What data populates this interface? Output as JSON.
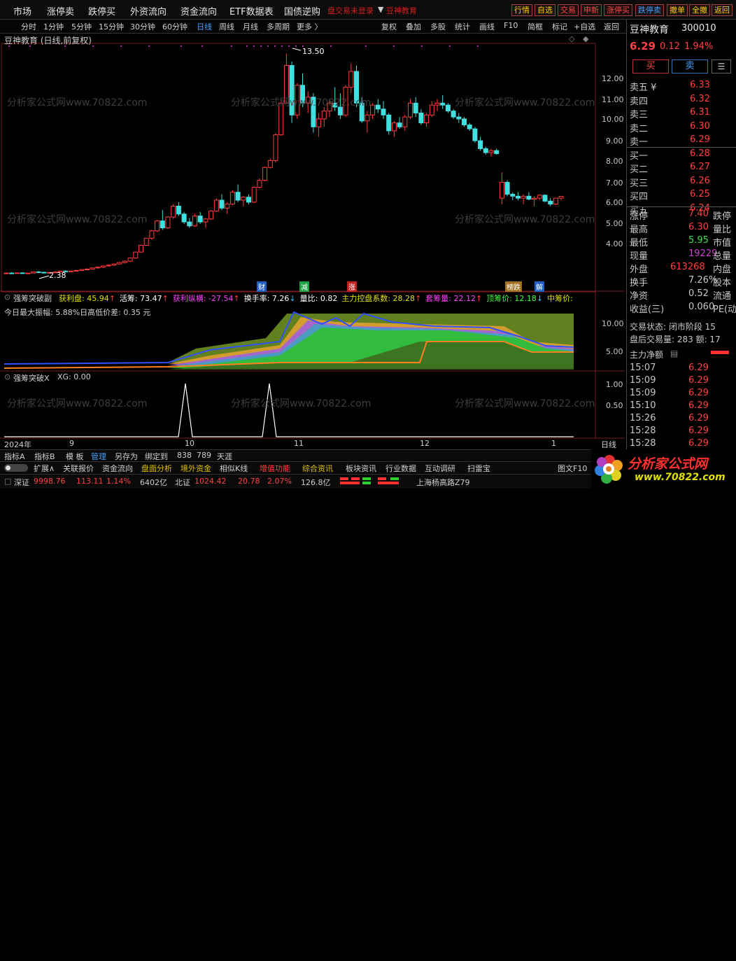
{
  "menu": {
    "items": [
      "市场",
      "涨停卖",
      "跌停买",
      "外资流向",
      "资金流向",
      "ETF数据表",
      "国债逆购"
    ],
    "notice": "盘交易未登录",
    "brand": "豆神教育",
    "right_buttons": [
      "行情",
      "自选",
      "交易",
      "申新",
      "涨停买",
      "跌停卖",
      "撤单",
      "全撤",
      "返回"
    ]
  },
  "toolbar": {
    "periods": [
      "分时",
      "1分钟",
      "5分钟",
      "15分钟",
      "30分钟",
      "60分钟",
      "日线",
      "周线",
      "月线",
      "多周期",
      "更多 〉"
    ],
    "tools": [
      "复权",
      "叠加",
      "多股",
      "统计",
      "画线",
      "F10",
      "简框",
      "标记",
      "+自选",
      "返回"
    ]
  },
  "main_chart": {
    "title": "豆神教育 (日线,前复权)",
    "high_label": "13.50",
    "low_label": "2.38",
    "y_ticks": [
      "12.00",
      "11.00",
      "10.00",
      "9.00",
      "8.00",
      "7.00",
      "6.00",
      "5.00",
      "4.00"
    ],
    "candles_ohlc": [
      [
        2.4,
        2.45,
        2.38,
        2.42
      ],
      [
        2.42,
        2.46,
        2.39,
        2.41
      ],
      [
        2.41,
        2.44,
        2.39,
        2.43
      ],
      [
        2.43,
        2.45,
        2.38,
        2.4
      ],
      [
        2.4,
        2.44,
        2.38,
        2.42
      ],
      [
        2.42,
        2.5,
        2.41,
        2.48
      ],
      [
        2.48,
        2.52,
        2.44,
        2.46
      ],
      [
        2.46,
        2.48,
        2.4,
        2.42
      ],
      [
        2.42,
        2.46,
        2.4,
        2.45
      ],
      [
        2.45,
        2.5,
        2.43,
        2.47
      ],
      [
        2.47,
        2.55,
        2.45,
        2.52
      ],
      [
        2.52,
        2.56,
        2.48,
        2.5
      ],
      [
        2.5,
        2.54,
        2.48,
        2.52
      ],
      [
        2.52,
        2.58,
        2.5,
        2.55
      ],
      [
        2.55,
        2.62,
        2.53,
        2.6
      ],
      [
        2.6,
        2.66,
        2.56,
        2.62
      ],
      [
        2.62,
        2.7,
        2.6,
        2.68
      ],
      [
        2.68,
        2.75,
        2.64,
        2.72
      ],
      [
        2.72,
        2.8,
        2.68,
        2.78
      ],
      [
        2.78,
        2.86,
        2.74,
        2.82
      ],
      [
        2.82,
        2.9,
        2.78,
        2.88
      ],
      [
        2.88,
        2.98,
        2.84,
        2.95
      ],
      [
        2.95,
        3.05,
        2.9,
        3.02
      ],
      [
        3.02,
        3.2,
        2.98,
        3.18
      ],
      [
        3.18,
        3.5,
        3.15,
        3.48
      ],
      [
        3.48,
        3.85,
        3.45,
        3.82
      ],
      [
        3.82,
        4.2,
        3.8,
        4.18
      ],
      [
        4.18,
        4.6,
        4.1,
        4.55
      ],
      [
        4.55,
        5.1,
        4.5,
        5.05
      ],
      [
        5.05,
        5.6,
        4.6,
        4.7
      ],
      [
        4.7,
        5.3,
        4.65,
        5.25
      ],
      [
        5.25,
        5.9,
        5.15,
        5.8
      ],
      [
        5.8,
        6.0,
        5.3,
        5.4
      ],
      [
        5.4,
        5.5,
        4.9,
        5.0
      ],
      [
        5.0,
        5.2,
        4.7,
        4.8
      ],
      [
        4.8,
        5.4,
        4.75,
        5.3
      ],
      [
        5.3,
        5.5,
        4.9,
        5.0
      ],
      [
        5.0,
        5.2,
        4.7,
        5.15
      ],
      [
        5.15,
        5.6,
        5.1,
        5.55
      ],
      [
        5.55,
        6.2,
        5.5,
        6.1
      ],
      [
        6.1,
        6.4,
        5.6,
        5.7
      ],
      [
        5.7,
        6.0,
        5.4,
        5.9
      ],
      [
        5.9,
        6.6,
        5.85,
        6.5
      ],
      [
        6.5,
        6.9,
        6.0,
        6.1
      ],
      [
        6.1,
        6.3,
        5.8,
        6.25
      ],
      [
        6.25,
        6.4,
        5.9,
        6.0
      ],
      [
        6.0,
        6.8,
        5.95,
        6.75
      ],
      [
        6.75,
        7.2,
        6.7,
        7.1
      ],
      [
        7.1,
        7.8,
        7.05,
        7.75
      ],
      [
        7.75,
        8.2,
        7.7,
        8.1
      ],
      [
        8.1,
        9.5,
        8.0,
        9.4
      ],
      [
        9.4,
        11.2,
        9.35,
        11.0
      ],
      [
        11.0,
        13.5,
        11.0,
        12.9
      ],
      [
        12.9,
        13.1,
        10.0,
        10.4
      ],
      [
        10.4,
        12.0,
        10.2,
        11.9
      ],
      [
        11.9,
        12.5,
        10.8,
        11.0
      ],
      [
        11.0,
        11.6,
        10.5,
        11.3
      ],
      [
        11.3,
        11.5,
        9.5,
        9.8
      ],
      [
        9.8,
        10.5,
        9.3,
        10.2
      ],
      [
        10.2,
        10.8,
        9.8,
        10.6
      ],
      [
        10.6,
        11.2,
        10.3,
        11.0
      ],
      [
        11.0,
        11.8,
        10.6,
        10.8
      ],
      [
        10.8,
        11.5,
        10.2,
        10.4
      ],
      [
        10.4,
        11.9,
        10.3,
        11.8
      ],
      [
        11.8,
        13.0,
        11.5,
        12.6
      ],
      [
        12.6,
        12.9,
        10.8,
        11.0
      ],
      [
        11.0,
        11.3,
        10.0,
        10.1
      ],
      [
        10.1,
        10.6,
        9.5,
        10.4
      ],
      [
        10.4,
        11.0,
        10.2,
        10.9
      ],
      [
        10.9,
        11.2,
        10.5,
        10.7
      ],
      [
        10.7,
        11.1,
        10.2,
        10.4
      ],
      [
        10.4,
        10.5,
        9.4,
        9.6
      ],
      [
        9.6,
        10.1,
        9.3,
        10.0
      ],
      [
        10.0,
        10.3,
        9.7,
        9.8
      ],
      [
        9.8,
        10.4,
        9.6,
        10.3
      ],
      [
        10.3,
        11.2,
        10.2,
        11.0
      ],
      [
        11.0,
        11.3,
        10.3,
        10.5
      ],
      [
        10.5,
        10.7,
        9.9,
        10.0
      ],
      [
        10.0,
        10.5,
        9.8,
        10.4
      ],
      [
        10.4,
        11.1,
        10.3,
        10.9
      ],
      [
        10.9,
        11.2,
        10.6,
        11.0
      ],
      [
        11.0,
        11.4,
        10.7,
        10.9
      ],
      [
        10.9,
        11.0,
        10.5,
        10.6
      ],
      [
        10.6,
        10.7,
        10.2,
        10.3
      ],
      [
        10.3,
        10.5,
        10.0,
        10.2
      ],
      [
        10.2,
        10.3,
        9.8,
        9.9
      ],
      [
        9.9,
        10.0,
        9.6,
        9.7
      ],
      [
        9.7,
        9.8,
        9.0,
        9.1
      ],
      [
        9.1,
        9.3,
        8.6,
        8.7
      ],
      [
        8.7,
        8.8,
        8.4,
        8.5
      ],
      [
        8.5,
        8.7,
        8.3,
        8.6
      ],
      [
        8.6,
        8.7,
        8.4,
        8.45
      ],
      [
        6.2,
        7.5,
        5.9,
        7.0
      ],
      [
        7.0,
        7.1,
        6.3,
        6.4
      ],
      [
        6.4,
        6.5,
        6.1,
        6.3
      ],
      [
        6.3,
        6.5,
        6.1,
        6.2
      ],
      [
        6.2,
        6.4,
        5.9,
        6.3
      ],
      [
        6.3,
        6.5,
        6.1,
        6.15
      ],
      [
        6.15,
        6.3,
        5.8,
        6.2
      ],
      [
        6.2,
        6.4,
        6.1,
        6.35
      ],
      [
        6.35,
        6.4,
        6.0,
        6.05
      ],
      [
        6.05,
        6.2,
        5.8,
        5.9
      ],
      [
        5.9,
        6.2,
        5.85,
        6.2
      ],
      [
        6.2,
        6.3,
        6.1,
        6.29
      ]
    ]
  },
  "indicator1": {
    "name": "强筹突破副",
    "items": [
      {
        "label": "获利盘: ",
        "value": "45.94",
        "arrow": "↑",
        "color": "#e0e000"
      },
      {
        "label": "活筹: ",
        "value": "73.47",
        "arrow": "↑",
        "color": "#ffffff"
      },
      {
        "label": "获利纵横: ",
        "value": "-27.54",
        "arrow": "↑",
        "color": "#ff40ff"
      },
      {
        "label": "换手率: ",
        "value": "7.26",
        "arrow": "↓",
        "color": "#ffffff"
      },
      {
        "label": "量比: ",
        "value": "0.82",
        "arrow": "",
        "color": "#ffffff"
      },
      {
        "label": "主力控盘系数: ",
        "value": "28.28",
        "arrow": "↑",
        "color": "#e0e000"
      },
      {
        "label": "套筹量: ",
        "value": "22.12",
        "arrow": "↑",
        "color": "#ff40ff"
      },
      {
        "label": "顶筹价: ",
        "value": "12.18",
        "arrow": "↓",
        "color": "#40ff40"
      },
      {
        "label": "中筹价: ",
        "value": "",
        "arrow": "",
        "color": "#e0e000"
      }
    ],
    "note": "今日最大振幅: 5.88%日高低价差: 0.35 元",
    "y_ticks": [
      "10.00",
      "5.00"
    ],
    "markers": [
      "财",
      "减",
      "涨",
      "榜跌",
      "解"
    ]
  },
  "indicator2": {
    "name": "强筹突破X",
    "label": "XG: 0.00",
    "y_ticks": [
      "1.00",
      "0.50"
    ]
  },
  "xaxis": {
    "labels": [
      "2024年",
      "9",
      "10",
      "11",
      "12",
      "1",
      "日线"
    ]
  },
  "watermark": "分析家公式网www.70822.com",
  "quote": {
    "name": "豆神教育",
    "code": "300010",
    "price": "6.29",
    "change": "0.12",
    "pct": "1.94%",
    "buy": "买",
    "sell": "卖",
    "asks": [
      {
        "label": "卖五 ¥",
        "price": "6.33"
      },
      {
        "label": "卖四",
        "price": "6.32"
      },
      {
        "label": "卖三",
        "price": "6.31"
      },
      {
        "label": "卖二",
        "price": "6.30"
      },
      {
        "label": "卖一",
        "price": "6.29"
      }
    ],
    "bids": [
      {
        "label": "买一",
        "price": "6.28"
      },
      {
        "label": "买二",
        "price": "6.27"
      },
      {
        "label": "买三",
        "price": "6.26"
      },
      {
        "label": "买四",
        "price": "6.25"
      },
      {
        "label": "买五",
        "price": "6.24"
      }
    ],
    "stats": [
      {
        "l": "涨停",
        "v": "7.40",
        "c": "#ff4040",
        "l2": "跌停"
      },
      {
        "l": "最高",
        "v": "6.30",
        "c": "#ff4040",
        "l2": "量比"
      },
      {
        "l": "最低",
        "v": "5.95",
        "c": "#40e040",
        "l2": "市值"
      },
      {
        "l": "现量",
        "v": "19229",
        "c": "#d040d0",
        "l2": "总量"
      },
      {
        "l": "外盘",
        "v": "613268",
        "c": "#ff4040",
        "l2": "内盘"
      },
      {
        "l": "换手",
        "v": "7.26%",
        "c": "#c8c8c8",
        "l2": "股本"
      },
      {
        "l": "净资",
        "v": "0.52",
        "c": "#c8c8c8",
        "l2": "流通"
      },
      {
        "l": "收益(三)",
        "v": "0.060",
        "c": "#c8c8c8",
        "l2": "PE(动"
      }
    ],
    "trade_state": "交易状态: 闭市阶段 15",
    "after_hours": "盘后交易量: 283  额: 17",
    "main_flow": "主力净额",
    "ticks": [
      {
        "t": "15:07",
        "p": "6.29"
      },
      {
        "t": "15:09",
        "p": "6.29"
      },
      {
        "t": "15:09",
        "p": "6.29"
      },
      {
        "t": "15:10",
        "p": "6.29"
      },
      {
        "t": "15:26",
        "p": "6.29"
      },
      {
        "t": "15:28",
        "p": "6.29"
      },
      {
        "t": "15:28",
        "p": "6.29"
      }
    ]
  },
  "bottom": {
    "row1": [
      "指标A",
      "指标B",
      "模 板",
      "管理",
      "另存为",
      "绑定到",
      "838",
      "789",
      "天涯"
    ],
    "row2": [
      "扩展∧",
      "关联报价",
      "资金流向",
      "盘面分析",
      "境外资金",
      "相似K线",
      "增值功能",
      "综合资讯",
      "板块资讯",
      "行业数据",
      "互动调研",
      "扫雷宝"
    ],
    "row2_right": "图文F10",
    "status": {
      "sz_label": "深证",
      "sz_val": "9998.76",
      "sz_chg": "113.11",
      "sz_pct": "1.14%",
      "sz_amt": "6402亿",
      "bz_label": "北证",
      "bz_val": "1024.42",
      "bz_chg": "20.78",
      "bz_pct": "2.07%",
      "bz_amt": "126.8亿",
      "addr": "上海杨高路Z79"
    },
    "logo_text": "分析家公式网",
    "logo_url": "www.70822.com"
  }
}
